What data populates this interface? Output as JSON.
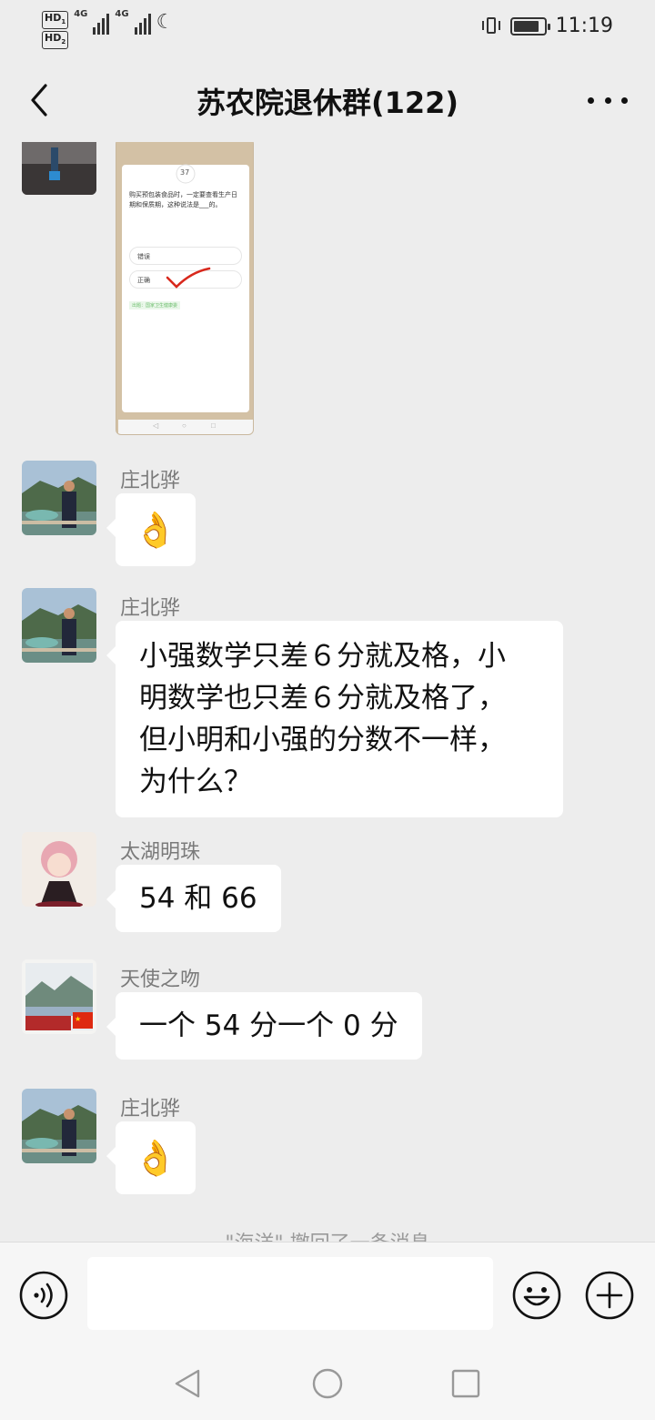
{
  "status_bar": {
    "hd1": "HD",
    "hd1_sub": "1",
    "hd2": "HD",
    "hd2_sub": "2",
    "net1": "4G",
    "net2": "4G",
    "time": "11:19",
    "battery_level": 0.85,
    "icons": [
      "signal-icon",
      "moon-icon",
      "vibrate-icon",
      "battery-icon"
    ]
  },
  "header": {
    "title": "苏农院退休群(122)"
  },
  "quiz_image": {
    "number": "37",
    "question": "购买预包装食品时，一定要查看生产日期和保质期，这种说法是___的。",
    "option_wrong": "错误",
    "option_right": "正确",
    "tag": "出题：国家卫生健康委"
  },
  "messages": [
    {
      "sender": "庄北骅",
      "type": "emoji",
      "emoji": "👌"
    },
    {
      "sender": "庄北骅",
      "type": "text",
      "lines": [
        "小强数学只差６分就及格，小",
        "明数学也只差６分就及格了，",
        "但小明和小强的分数不一样，",
        "为什么？"
      ]
    },
    {
      "sender": "太湖明珠",
      "type": "text",
      "text": "54 和 66"
    },
    {
      "sender": "天使之吻",
      "type": "text",
      "text": "一个 54 分一个 0 分"
    },
    {
      "sender": "庄北骅",
      "type": "emoji",
      "emoji": "👌"
    }
  ],
  "recall_notice": "\"海洋\" 撤回了一条消息",
  "input": {
    "placeholder": ""
  },
  "colors": {
    "background": "#ededed",
    "bubble": "#ffffff",
    "sender_text": "#7a7a7a"
  }
}
